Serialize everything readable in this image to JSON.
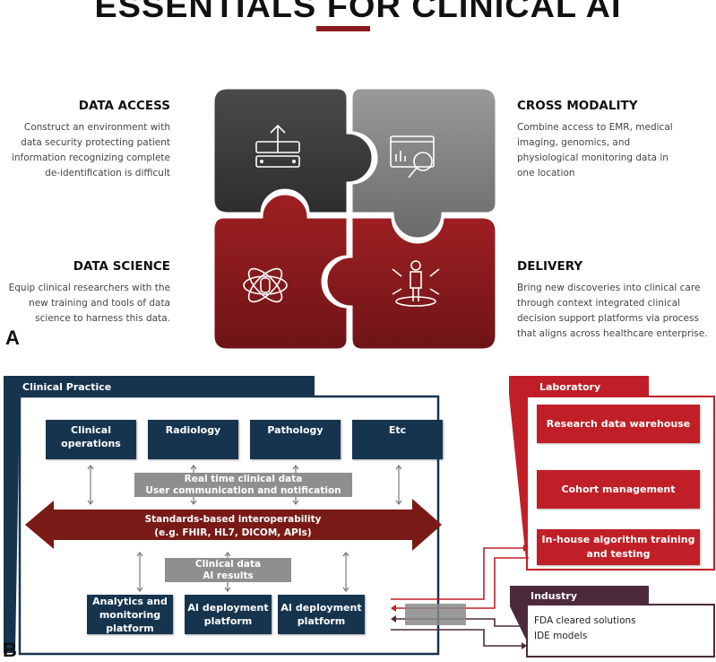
{
  "title": "ESSENTIALS FOR CLINICAL AI",
  "panel_a": {
    "letter": "A",
    "sections": [
      {
        "heading": "DATA ACCESS",
        "lines": [
          "Construct an environment with",
          "data security protecting patient",
          "information recognizing complete",
          "de-identification is difficult"
        ],
        "icon": "server-upload-icon"
      },
      {
        "heading": "CROSS MODALITY",
        "lines": [
          "Combine access to EMR, medical",
          "imaging, genomics, and",
          "physiological monitoring data in",
          "one location"
        ],
        "icon": "data-search-icon"
      },
      {
        "heading": "DATA SCIENCE",
        "lines": [
          "Equip clinical researchers with the",
          "new training and tools of data",
          "science to harness this data."
        ],
        "icon": "atom-database-icon"
      },
      {
        "heading": "DELIVERY",
        "lines": [
          "Bring new discoveries into clinical care",
          "through context integrated clinical",
          "decision support platforms via process",
          "that aligns across healthcare enterprise."
        ],
        "icon": "person-expansion-icon"
      }
    ],
    "colors": {
      "dark": "#3a3a3a",
      "grey": "#8a8a8a",
      "red": "#8e1b1e"
    }
  },
  "panel_b": {
    "letter": "B",
    "clinical_practice": {
      "label": "Clinical Practice",
      "departments": [
        [
          "Clinical",
          "operations"
        ],
        [
          "Radiology"
        ],
        [
          "Pathology"
        ],
        [
          "Etc"
        ]
      ],
      "realtime_box": [
        "Real time clinical data",
        "User communication and notification"
      ],
      "interop_arrow": [
        "Standards-based interoperability",
        "(e.g. FHIR, HL7, DICOM, APIs)"
      ],
      "clinical_box": [
        "Clinical data",
        "AI results"
      ],
      "platforms": [
        [
          "Analytics and",
          "monitoring",
          "platform"
        ],
        [
          "AI deployment",
          "platform"
        ],
        [
          "AI deployment",
          "platform"
        ]
      ],
      "color": "#17344f"
    },
    "laboratory": {
      "label": "Laboratory",
      "items": [
        [
          "Research data warehouse"
        ],
        [
          "Cohort management"
        ],
        [
          "In-house algorithm training",
          "and testing"
        ]
      ],
      "color": "#c11f27"
    },
    "industry": {
      "label": "Industry",
      "items": [
        "FDA cleared solutions",
        "IDE models"
      ],
      "color": "#4d2a3b"
    }
  }
}
